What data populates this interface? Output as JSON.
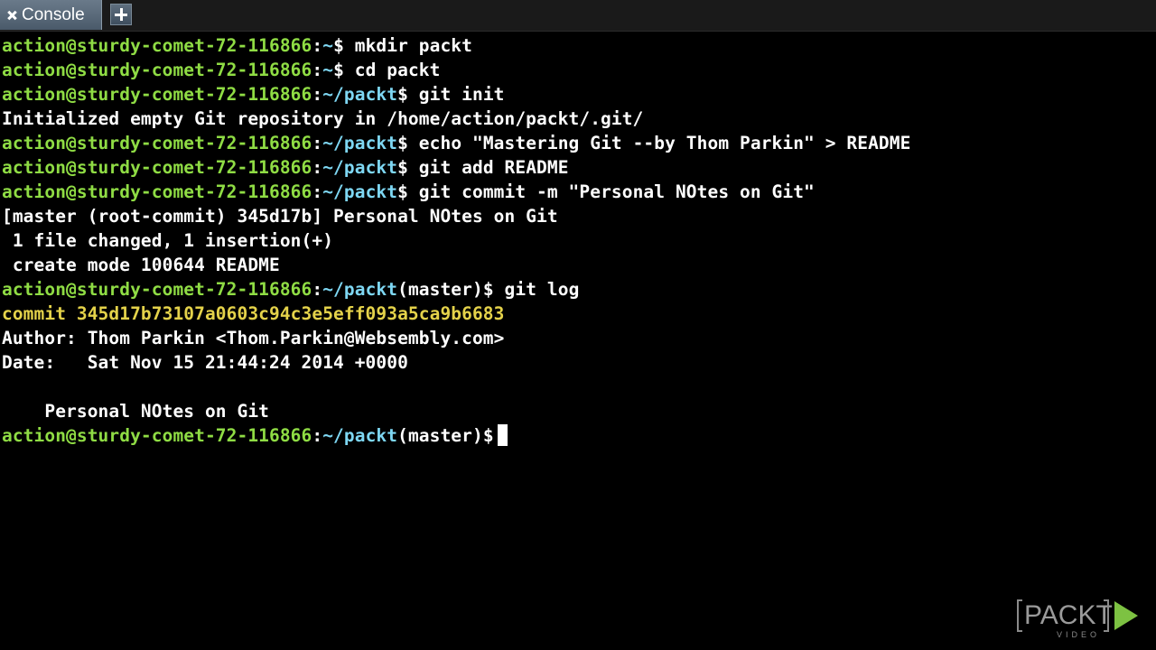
{
  "tab": {
    "label": "Console"
  },
  "prompt": {
    "user": "action@sturdy-comet-72-116866",
    "sep": ":",
    "home": "~",
    "packt": "~/packt",
    "branch": "(master)",
    "dollar": "$"
  },
  "lines": [
    {
      "cmd": " mkdir packt"
    },
    {
      "cmd": " cd packt"
    },
    {
      "cmd": " git init"
    },
    {
      "out": "Initialized empty Git repository in /home/action/packt/.git/"
    },
    {
      "cmd": " echo \"Mastering Git --by Thom Parkin\" > README"
    },
    {
      "cmd": " git add README"
    },
    {
      "cmd": " git commit -m \"Personal NOtes on Git\""
    },
    {
      "out": "[master (root-commit) 345d17b] Personal NOtes on Git"
    },
    {
      "out": " 1 file changed, 1 insertion(+)"
    },
    {
      "out": " create mode 100644 README"
    },
    {
      "cmd": " git log"
    },
    {
      "out": "commit 345d17b73107a0603c94c3e5eff093a5ca9b6683"
    },
    {
      "out": "Author: Thom Parkin <Thom.Parkin@Websembly.com>"
    },
    {
      "out": "Date:   Sat Nov 15 21:44:24 2014 +0000"
    },
    {
      "out": ""
    },
    {
      "out": "    Personal NOtes on Git"
    }
  ],
  "logo": {
    "text": "PACKT",
    "sub": "VIDEO",
    "brand_color": "#7dc242"
  },
  "colors": {
    "user": "#8fdc44",
    "path": "#7ed7f3",
    "commit": "#e4d24a",
    "background": "#000000"
  },
  "icons": {
    "tab_close": "close-icon",
    "new_tab": "plus-icon",
    "logo_play": "play-icon"
  }
}
